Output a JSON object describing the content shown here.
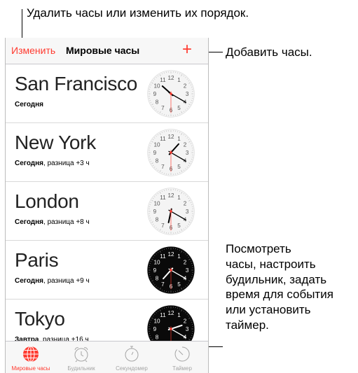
{
  "callouts": {
    "top": "Удалить часы или изменить их порядок.",
    "add": "Добавить часы.",
    "right_lines": [
      "Посмотреть",
      "часы, настроить",
      "будильник, задать",
      "время для события",
      "или установить",
      "таймер."
    ]
  },
  "navbar": {
    "edit_label": "Изменить",
    "title": "Мировые часы",
    "add_label": "+"
  },
  "clocks": [
    {
      "city": "San Francisco",
      "day": "Сегодня",
      "diff": "",
      "dark": false,
      "hour": 10.4,
      "minute": 20,
      "second": 30
    },
    {
      "city": "New York",
      "day": "Сегодня",
      "diff": ", разница +3 ч",
      "dark": false,
      "hour": 1.4,
      "minute": 20,
      "second": 30
    },
    {
      "city": "London",
      "day": "Сегодня",
      "diff": ", разница +8 ч",
      "dark": false,
      "hour": 6.4,
      "minute": 20,
      "second": 30
    },
    {
      "city": "Paris",
      "day": "Сегодня",
      "diff": ", разница +9 ч",
      "dark": true,
      "hour": 7.4,
      "minute": 20,
      "second": 30
    },
    {
      "city": "Tokyo",
      "day": "Завтра",
      "diff": ", разница +16 ч",
      "dark": true,
      "hour": 2.4,
      "minute": 20,
      "second": 30
    }
  ],
  "clock_numbers": [
    "12",
    "1",
    "2",
    "3",
    "4",
    "5",
    "6",
    "7",
    "8",
    "9",
    "10",
    "11"
  ],
  "tabs": [
    {
      "label": "Мировые часы",
      "icon": "globe-icon",
      "active": true
    },
    {
      "label": "Будильник",
      "icon": "alarm-icon",
      "active": false
    },
    {
      "label": "Секундомер",
      "icon": "stopwatch-icon",
      "active": false
    },
    {
      "label": "Таймер",
      "icon": "timer-icon",
      "active": false
    }
  ],
  "colors": {
    "accent": "#ff3b30",
    "tab_inactive": "#a4a4a4"
  }
}
